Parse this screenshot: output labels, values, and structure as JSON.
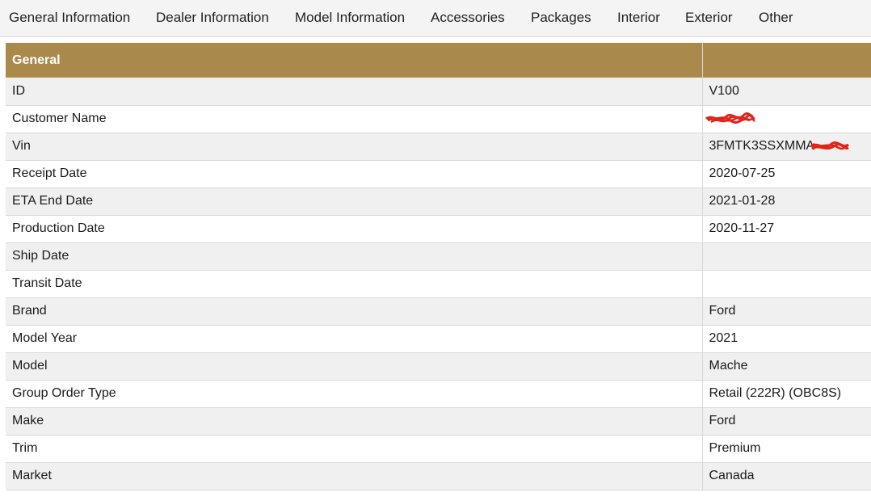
{
  "tabs": [
    {
      "label": "General Information"
    },
    {
      "label": "Dealer Information"
    },
    {
      "label": "Model Information"
    },
    {
      "label": "Accessories"
    },
    {
      "label": "Packages"
    },
    {
      "label": "Interior"
    },
    {
      "label": "Exterior"
    },
    {
      "label": "Other"
    }
  ],
  "section": {
    "title": "General",
    "value_header": ""
  },
  "rows": [
    {
      "label": "ID",
      "value": "V100"
    },
    {
      "label": "Customer Name",
      "value": ""
    },
    {
      "label": "Vin",
      "value": "3FMTK3SSXMMA"
    },
    {
      "label": "Receipt Date",
      "value": "2020-07-25"
    },
    {
      "label": "ETA End Date",
      "value": "2021-01-28"
    },
    {
      "label": "Production Date",
      "value": "2020-11-27"
    },
    {
      "label": "Ship Date",
      "value": ""
    },
    {
      "label": "Transit Date",
      "value": ""
    },
    {
      "label": "Brand",
      "value": "Ford"
    },
    {
      "label": "Model Year",
      "value": "2021"
    },
    {
      "label": "Model",
      "value": "Mache"
    },
    {
      "label": "Group Order Type",
      "value": "Retail (222R) (OBC8S)"
    },
    {
      "label": "Make",
      "value": "Ford"
    },
    {
      "label": "Trim",
      "value": "Premium"
    },
    {
      "label": "Market",
      "value": "Canada"
    }
  ],
  "colors": {
    "header_bg": "#a98a4c",
    "redaction": "#e0251b",
    "row_alt": "#f0f0f0"
  }
}
